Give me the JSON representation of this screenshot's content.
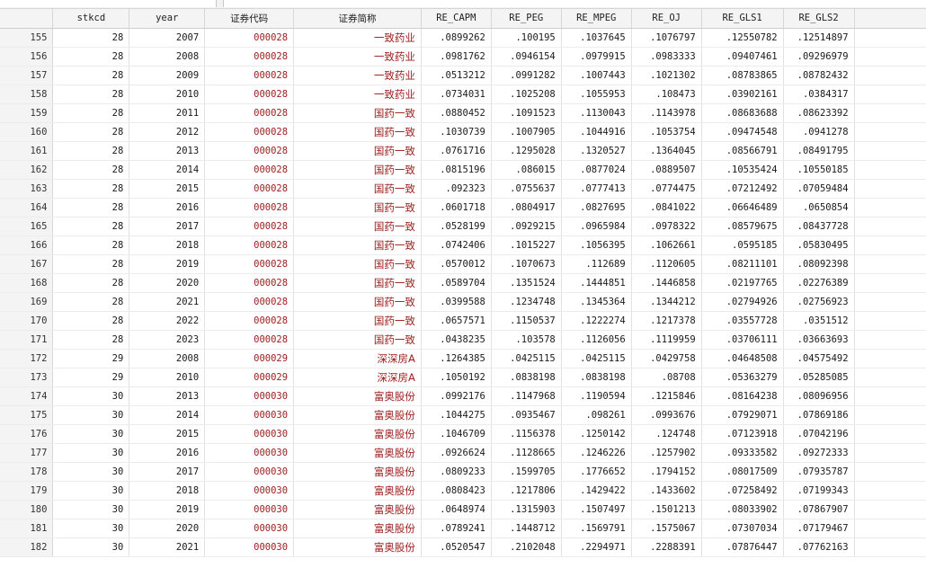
{
  "columns": [
    "stkcd",
    "year",
    "证券代码",
    "证券简称",
    "RE_CAPM",
    "RE_PEG",
    "RE_MPEG",
    "RE_OJ",
    "RE_GLS1",
    "RE_GLS2"
  ],
  "rows": [
    [
      "155",
      "28",
      "2007",
      "000028",
      "一致药业",
      ".0899262",
      ".100195",
      ".1037645",
      ".1076797",
      ".12550782",
      ".12514897"
    ],
    [
      "156",
      "28",
      "2008",
      "000028",
      "一致药业",
      ".0981762",
      ".0946154",
      ".0979915",
      ".0983333",
      ".09407461",
      ".09296979"
    ],
    [
      "157",
      "28",
      "2009",
      "000028",
      "一致药业",
      ".0513212",
      ".0991282",
      ".1007443",
      ".1021302",
      ".08783865",
      ".08782432"
    ],
    [
      "158",
      "28",
      "2010",
      "000028",
      "一致药业",
      ".0734031",
      ".1025208",
      ".1055953",
      ".108473",
      ".03902161",
      ".0384317"
    ],
    [
      "159",
      "28",
      "2011",
      "000028",
      "国药一致",
      ".0880452",
      ".1091523",
      ".1130043",
      ".1143978",
      ".08683688",
      ".08623392"
    ],
    [
      "160",
      "28",
      "2012",
      "000028",
      "国药一致",
      ".1030739",
      ".1007905",
      ".1044916",
      ".1053754",
      ".09474548",
      ".0941278"
    ],
    [
      "161",
      "28",
      "2013",
      "000028",
      "国药一致",
      ".0761716",
      ".1295028",
      ".1320527",
      ".1364045",
      ".08566791",
      ".08491795"
    ],
    [
      "162",
      "28",
      "2014",
      "000028",
      "国药一致",
      ".0815196",
      ".086015",
      ".0877024",
      ".0889507",
      ".10535424",
      ".10550185"
    ],
    [
      "163",
      "28",
      "2015",
      "000028",
      "国药一致",
      ".092323",
      ".0755637",
      ".0777413",
      ".0774475",
      ".07212492",
      ".07059484"
    ],
    [
      "164",
      "28",
      "2016",
      "000028",
      "国药一致",
      ".0601718",
      ".0804917",
      ".0827695",
      ".0841022",
      ".06646489",
      ".0650854"
    ],
    [
      "165",
      "28",
      "2017",
      "000028",
      "国药一致",
      ".0528199",
      ".0929215",
      ".0965984",
      ".0978322",
      ".08579675",
      ".08437728"
    ],
    [
      "166",
      "28",
      "2018",
      "000028",
      "国药一致",
      ".0742406",
      ".1015227",
      ".1056395",
      ".1062661",
      ".0595185",
      ".05830495"
    ],
    [
      "167",
      "28",
      "2019",
      "000028",
      "国药一致",
      ".0570012",
      ".1070673",
      ".112689",
      ".1120605",
      ".08211101",
      ".08092398"
    ],
    [
      "168",
      "28",
      "2020",
      "000028",
      "国药一致",
      ".0589704",
      ".1351524",
      ".1444851",
      ".1446858",
      ".02197765",
      ".02276389"
    ],
    [
      "169",
      "28",
      "2021",
      "000028",
      "国药一致",
      ".0399588",
      ".1234748",
      ".1345364",
      ".1344212",
      ".02794926",
      ".02756923"
    ],
    [
      "170",
      "28",
      "2022",
      "000028",
      "国药一致",
      ".0657571",
      ".1150537",
      ".1222274",
      ".1217378",
      ".03557728",
      ".0351512"
    ],
    [
      "171",
      "28",
      "2023",
      "000028",
      "国药一致",
      ".0438235",
      ".103578",
      ".1126056",
      ".1119959",
      ".03706111",
      ".03663693"
    ],
    [
      "172",
      "29",
      "2008",
      "000029",
      "深深房A",
      ".1264385",
      ".0425115",
      ".0425115",
      ".0429758",
      ".04648508",
      ".04575492"
    ],
    [
      "173",
      "29",
      "2010",
      "000029",
      "深深房A",
      ".1050192",
      ".0838198",
      ".0838198",
      ".08708",
      ".05363279",
      ".05285085"
    ],
    [
      "174",
      "30",
      "2013",
      "000030",
      "富奥股份",
      ".0992176",
      ".1147968",
      ".1190594",
      ".1215846",
      ".08164238",
      ".08096956"
    ],
    [
      "175",
      "30",
      "2014",
      "000030",
      "富奥股份",
      ".1044275",
      ".0935467",
      ".098261",
      ".0993676",
      ".07929071",
      ".07869186"
    ],
    [
      "176",
      "30",
      "2015",
      "000030",
      "富奥股份",
      ".1046709",
      ".1156378",
      ".1250142",
      ".124748",
      ".07123918",
      ".07042196"
    ],
    [
      "177",
      "30",
      "2016",
      "000030",
      "富奥股份",
      ".0926624",
      ".1128665",
      ".1246226",
      ".1257902",
      ".09333582",
      ".09272333"
    ],
    [
      "178",
      "30",
      "2017",
      "000030",
      "富奥股份",
      ".0809233",
      ".1599705",
      ".1776652",
      ".1794152",
      ".08017509",
      ".07935787"
    ],
    [
      "179",
      "30",
      "2018",
      "000030",
      "富奥股份",
      ".0808423",
      ".1217806",
      ".1429422",
      ".1433602",
      ".07258492",
      ".07199343"
    ],
    [
      "180",
      "30",
      "2019",
      "000030",
      "富奥股份",
      ".0648974",
      ".1315903",
      ".1507497",
      ".1501213",
      ".08033902",
      ".07867907"
    ],
    [
      "181",
      "30",
      "2020",
      "000030",
      "富奥股份",
      ".0789241",
      ".1448712",
      ".1569791",
      ".1575067",
      ".07307034",
      ".07179467"
    ],
    [
      "182",
      "30",
      "2021",
      "000030",
      "富奥股份",
      ".0520547",
      ".2102048",
      ".2294971",
      ".2288391",
      ".07876447",
      ".07762163"
    ]
  ]
}
